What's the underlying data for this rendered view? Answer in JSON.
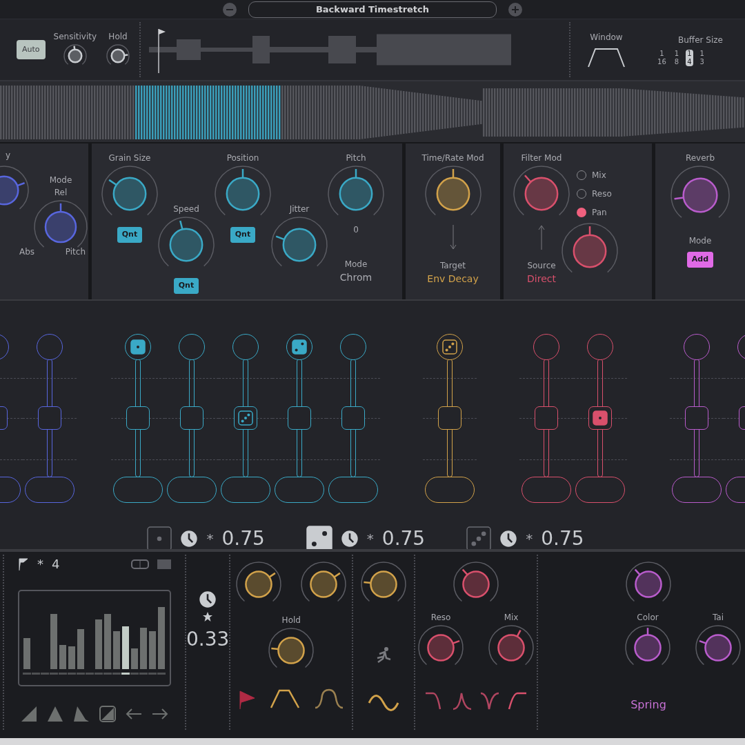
{
  "header": {
    "preset": "Backward Timestretch"
  },
  "detector": {
    "auto": {
      "label": "Auto",
      "on": true
    },
    "knobs": [
      {
        "label": "Sensitivity"
      },
      {
        "label": "Hold"
      }
    ]
  },
  "window": {
    "label": "Window"
  },
  "buffer_size": {
    "label": "Buffer Size",
    "options": [
      {
        "num": "1",
        "den": "16",
        "selected": false
      },
      {
        "num": "1",
        "den": "8",
        "selected": false
      },
      {
        "num": "1",
        "den": "4",
        "selected": true
      },
      {
        "num": "1",
        "den": "3",
        "selected": false
      }
    ]
  },
  "density_panel": {
    "title": "y",
    "mode_label": "Mode",
    "mode_value": "Rel",
    "left": "Abs",
    "right": "Pitch"
  },
  "grain_panel": {
    "knobs": [
      {
        "label": "Grain Size",
        "quantize": {
          "label": "Qnt",
          "on": true
        }
      },
      {
        "label": "Speed",
        "quantize": {
          "label": "Qnt",
          "on": true
        }
      },
      {
        "label": "Position",
        "quantize": {
          "label": "Qnt",
          "on": true
        }
      },
      {
        "label": "Jitter"
      },
      {
        "label": "Pitch",
        "value": "0",
        "mode_label": "Mode",
        "mode_value": "Chrom"
      }
    ]
  },
  "time_mod_panel": {
    "title": "Time/Rate Mod",
    "target_label": "Target",
    "target_value": "Env Decay"
  },
  "filter_mod_panel": {
    "title": "Filter Mod",
    "options": [
      {
        "label": "Mix",
        "selected": false
      },
      {
        "label": "Reso",
        "selected": false
      },
      {
        "label": "Pan",
        "selected": true
      }
    ],
    "source_label": "Source",
    "source_value": "Direct"
  },
  "reverb_panel": {
    "title": "Reverb",
    "mode_label": "Mode",
    "mode_button": {
      "label": "Add",
      "on": true
    }
  },
  "lane_groups": [
    {
      "color": "#5866de",
      "lanes": [
        {
          "level": 0.5
        },
        {
          "level": 0.5
        }
      ]
    },
    {
      "color": "#3aa9c6",
      "lanes": [
        {
          "level": 0.5,
          "top": {
            "kind": "one"
          }
        },
        {
          "level": 0.5
        },
        {
          "level": 0.5,
          "mid": {
            "kind": "diag"
          }
        },
        {
          "level": 0.5,
          "top": {
            "kind": "two"
          }
        },
        {
          "level": 0.5
        }
      ]
    },
    {
      "color": "#d2a24a",
      "lanes": [
        {
          "level": 0.5,
          "top": {
            "kind": "diag"
          }
        }
      ]
    },
    {
      "color": "#d9506c",
      "lanes": [
        {
          "level": 0.5
        },
        {
          "level": 0.5,
          "mid": {
            "kind": "one"
          }
        }
      ]
    },
    {
      "color": "#b95ccc",
      "lanes": [
        {
          "level": 0.5
        },
        {
          "level": 0.5
        }
      ]
    }
  ],
  "multipliers": [
    {
      "kind": "one",
      "selected": false,
      "symbol": "*",
      "value": "0.75"
    },
    {
      "kind": "two",
      "selected": true,
      "symbol": "*",
      "value": "0.75"
    },
    {
      "kind": "diag",
      "selected": false,
      "symbol": "*",
      "value": "0.75"
    }
  ],
  "sequencer": {
    "symbol": "*",
    "count": "4"
  },
  "rate": {
    "value": "0.33"
  },
  "envelope_panel": {
    "hold": {
      "label": "Hold"
    }
  },
  "filter_panel": {
    "knobs": [
      {
        "label": "Reso"
      },
      {
        "label": "Mix"
      }
    ]
  },
  "reverb_bottom_panel": {
    "knobs": [
      {
        "label": "Color"
      },
      {
        "label": "Tai"
      }
    ],
    "type": "Spring"
  }
}
